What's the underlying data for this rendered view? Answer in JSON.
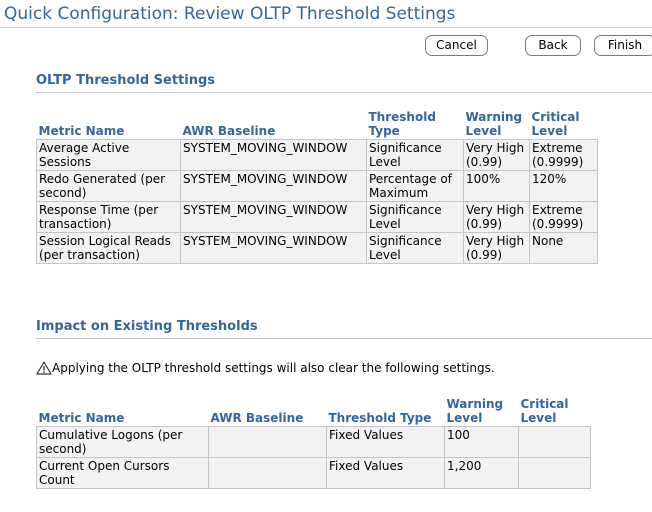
{
  "page": {
    "title": "Quick Configuration: Review OLTP Threshold Settings"
  },
  "buttons": {
    "cancel": "Cancel",
    "back": "Back",
    "finish": "Finish"
  },
  "oltp_section": {
    "heading": "OLTP Threshold Settings",
    "columns": [
      "Metric Name",
      "AWR Baseline",
      "Threshold Type",
      "Warning Level",
      "Critical Level"
    ],
    "rows": [
      [
        "Average Active Sessions",
        "SYSTEM_MOVING_WINDOW",
        "Significance Level",
        "Very High (0.99)",
        "Extreme (0.9999)"
      ],
      [
        "Redo Generated (per second)",
        "SYSTEM_MOVING_WINDOW",
        "Percentage of Maximum",
        "100%",
        "120%"
      ],
      [
        "Response Time (per transaction)",
        "SYSTEM_MOVING_WINDOW",
        "Significance Level",
        "Very High (0.99)",
        "Extreme (0.9999)"
      ],
      [
        "Session Logical Reads (per transaction)",
        "SYSTEM_MOVING_WINDOW",
        "Significance Level",
        "Very High (0.99)",
        "None"
      ]
    ]
  },
  "impact_section": {
    "heading": "Impact on Existing Thresholds",
    "warning_icon": "warning-triangle-icon",
    "warning_text": "Applying the OLTP threshold settings will also clear the following settings.",
    "columns": [
      "Metric Name",
      "AWR Baseline",
      "Threshold Type",
      "Warning Level",
      "Critical Level"
    ],
    "rows": [
      [
        "Cumulative Logons (per second)",
        "",
        "Fixed Values",
        "100",
        ""
      ],
      [
        "Current Open Cursors Count",
        "",
        "Fixed Values",
        "1,200",
        ""
      ]
    ]
  },
  "colors": {
    "accent": "#336699",
    "border": "#c5c5c5",
    "cell_bg": "#f2f2f2"
  }
}
